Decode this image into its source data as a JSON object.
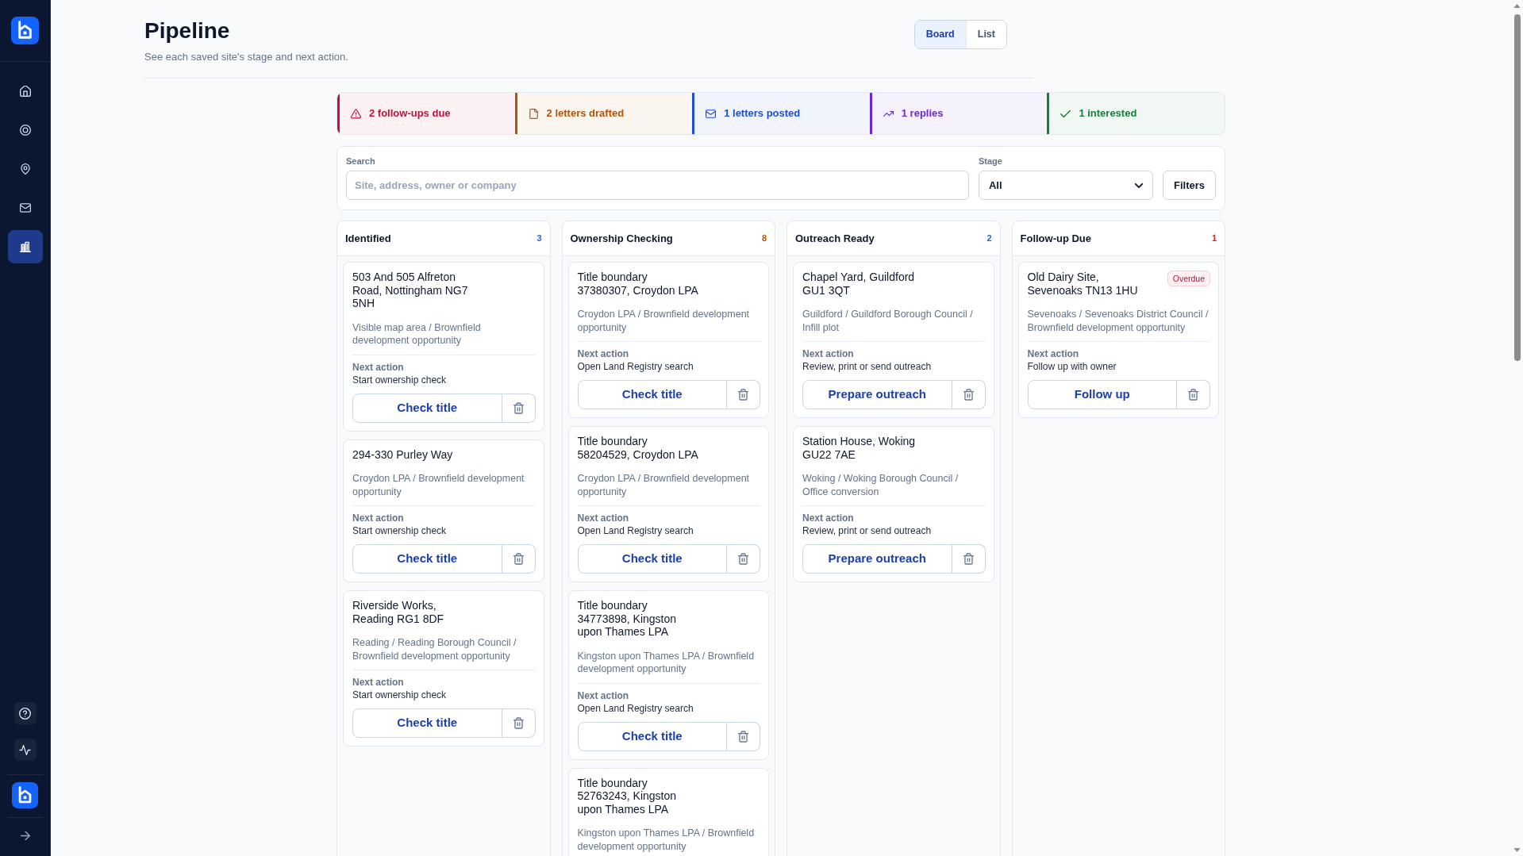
{
  "sidebar": {
    "nav_items": [
      {
        "selected": false
      },
      {
        "selected": false
      },
      {
        "selected": false
      },
      {
        "selected": false
      },
      {
        "selected": true
      }
    ]
  },
  "header": {
    "title": "Pipeline",
    "subtitle": "See each saved site's stage and next action.",
    "view_toggle": [
      {
        "label": "Board",
        "selected": true
      },
      {
        "label": "List",
        "selected": false
      }
    ]
  },
  "summary": [
    {
      "kind": "followups",
      "label": "2 follow-ups due",
      "color": "#be123c"
    },
    {
      "kind": "drafted",
      "label": "2 letters drafted",
      "color": "#b45309"
    },
    {
      "kind": "posted",
      "label": "1 letters posted",
      "color": "#1d4ed8"
    },
    {
      "kind": "replies",
      "label": "1 replies",
      "color": "#6d28d9"
    },
    {
      "kind": "interested",
      "label": "1 interested",
      "color": "#15803d"
    }
  ],
  "filters": {
    "search": {
      "label": "Search",
      "placeholder": "Site, address, owner or company"
    },
    "stage": {
      "label": "Stage",
      "value": "All"
    },
    "filters_button": "Filters"
  },
  "columns": [
    {
      "title": "Identified",
      "count": "3",
      "color": "#2563eb",
      "cards": [
        {
          "title": "503 And 505 Alfreton Road, Nottingham NG7 5NH",
          "meta": "Visible map area / Brownfield development opportunity",
          "next_action_label": "Next action",
          "next_action": "Start ownership check",
          "action": "Check title"
        },
        {
          "title": "294-330 Purley Way",
          "meta": "Croydon LPA / Brownfield development opportunity",
          "next_action_label": "Next action",
          "next_action": "Start ownership check",
          "action": "Check title"
        },
        {
          "title": "Riverside Works, Reading RG1 8DF",
          "meta": "Reading / Reading Borough Council / Brownfield development opportunity",
          "next_action_label": "Next action",
          "next_action": "Start ownership check",
          "action": "Check title"
        }
      ]
    },
    {
      "title": "Ownership Checking",
      "count": "8",
      "color": "#b45309",
      "cards": [
        {
          "title": "Title boundary 37380307, Croydon LPA",
          "meta": "Croydon LPA / Brownfield development opportunity",
          "next_action_label": "Next action",
          "next_action": "Open Land Registry search",
          "action": "Check title"
        },
        {
          "title": "Title boundary 58204529, Croydon LPA",
          "meta": "Croydon LPA / Brownfield development opportunity",
          "next_action_label": "Next action",
          "next_action": "Open Land Registry search",
          "action": "Check title"
        },
        {
          "title": "Title boundary 34773898, Kingston upon Thames LPA",
          "meta": "Kingston upon Thames LPA / Brownfield development opportunity",
          "next_action_label": "Next action",
          "next_action": "Open Land Registry search",
          "action": "Check title"
        },
        {
          "title": "Title boundary 52763243, Kingston upon Thames LPA",
          "meta": "Kingston upon Thames LPA / Brownfield development opportunity"
        }
      ]
    },
    {
      "title": "Outreach Ready",
      "count": "2",
      "color": "#2563eb",
      "cards": [
        {
          "title": "Chapel Yard, Guildford GU1 3QT",
          "meta": "Guildford / Guildford Borough Council / Infill plot",
          "next_action_label": "Next action",
          "next_action": "Review, print or send outreach",
          "action": "Prepare outreach"
        },
        {
          "title": "Station House, Woking GU22 7AE",
          "meta": "Woking / Woking Borough Council / Office conversion",
          "next_action_label": "Next action",
          "next_action": "Review, print or send outreach",
          "action": "Prepare outreach"
        }
      ]
    },
    {
      "title": "Follow-up Due",
      "count": "1",
      "color": "#dc2626",
      "cards": [
        {
          "title": "Old Dairy Site, Sevenoaks TN13 1HU",
          "badge": "Overdue",
          "meta": "Sevenoaks / Sevenoaks District Council / Brownfield development opportunity",
          "next_action_label": "Next action",
          "next_action": "Follow up with owner",
          "action": "Follow up"
        }
      ]
    }
  ]
}
